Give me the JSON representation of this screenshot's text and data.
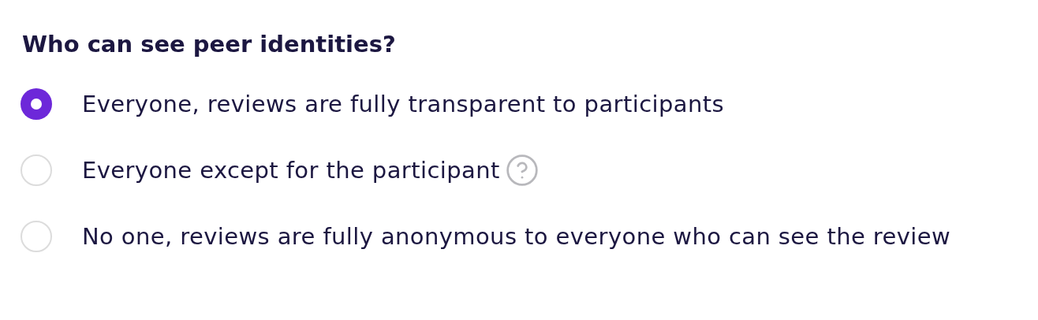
{
  "question": "Who can see peer identities?",
  "options": [
    {
      "label": "Everyone, reviews are fully transparent to participants",
      "selected": true,
      "has_help": false
    },
    {
      "label": "Everyone except for the participant",
      "selected": false,
      "has_help": true
    },
    {
      "label": "No one, reviews are fully anonymous to everyone who can see the review",
      "selected": false,
      "has_help": false
    }
  ]
}
